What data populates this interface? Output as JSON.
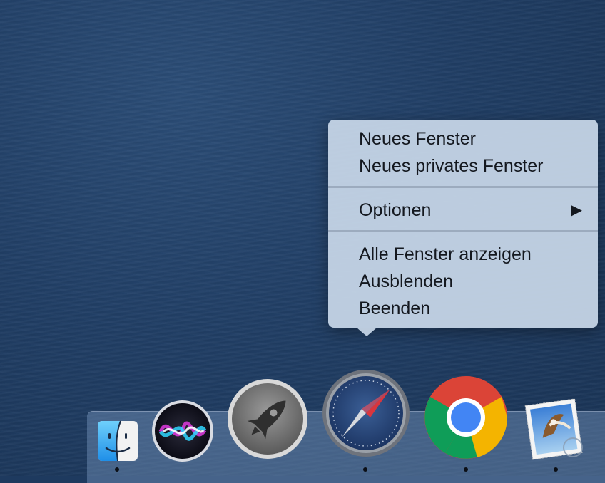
{
  "context_menu": {
    "app": "Safari",
    "items": [
      {
        "label": "Neues Fenster"
      },
      {
        "label": "Neues privates Fenster"
      },
      {
        "label": "Optionen",
        "submenu_arrow": "▶"
      },
      {
        "label": "Alle Fenster anzeigen"
      },
      {
        "label": "Ausblenden"
      },
      {
        "label": "Beenden"
      }
    ]
  },
  "dock": {
    "apps": [
      {
        "name": "Finder",
        "icon": "finder-icon",
        "running": true
      },
      {
        "name": "Siri",
        "icon": "siri-icon",
        "running": false
      },
      {
        "name": "Launchpad",
        "icon": "launchpad-icon",
        "running": false
      },
      {
        "name": "Safari",
        "icon": "safari-icon",
        "running": true
      },
      {
        "name": "Google Chrome",
        "icon": "chrome-icon",
        "running": true
      },
      {
        "name": "Mail",
        "icon": "mail-icon",
        "running": true
      }
    ]
  },
  "colors": {
    "menu_background": "#c8d7e8",
    "menu_text": "#14181f",
    "desktop": "#213f66"
  }
}
